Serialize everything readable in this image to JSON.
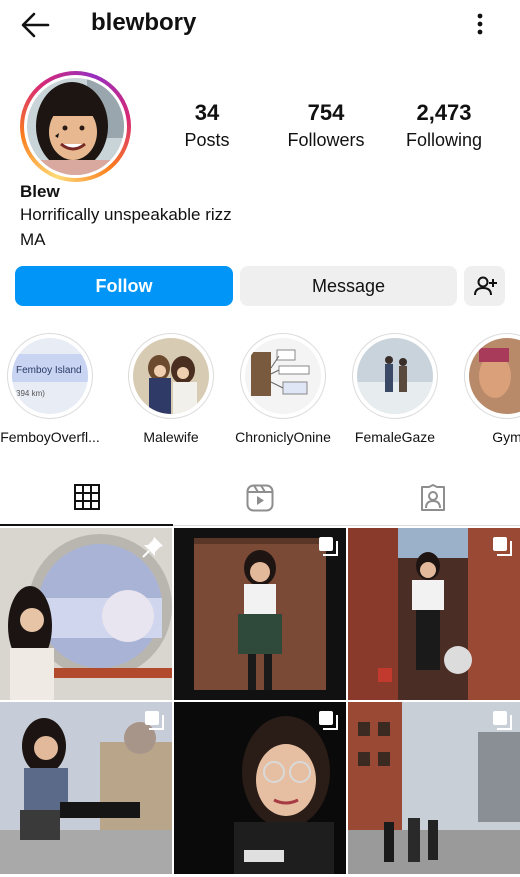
{
  "header": {
    "username": "blewbory"
  },
  "profile": {
    "name": "Blew",
    "bio": "Horrifically unspeakable rizz",
    "location": "MA"
  },
  "stats": [
    {
      "value": "34",
      "label": "Posts"
    },
    {
      "value": "754",
      "label": "Followers"
    },
    {
      "value": "2,473",
      "label": "Following"
    }
  ],
  "actions": {
    "follow_label": "Follow",
    "message_label": "Message"
  },
  "highlights": [
    {
      "label": "FemboyOverfl...",
      "image_text": "Femboy Island",
      "image_subtext": "394 km)"
    },
    {
      "label": "Malewife"
    },
    {
      "label": "ChroniclyOnine"
    },
    {
      "label": "FemaleGaze"
    },
    {
      "label": "Gym"
    }
  ],
  "tabs": [
    {
      "icon": "grid-icon"
    },
    {
      "icon": "reels-icon"
    },
    {
      "icon": "tagged-icon"
    }
  ],
  "colors": {
    "follow_blue": "#0095f6",
    "button_gray": "#efefef",
    "divider": "#dbdbdb"
  },
  "posts": [
    {
      "badge": "pin-icon"
    },
    {
      "badge": "multiple-icon"
    },
    {
      "badge": "multiple-icon"
    },
    {
      "badge": "multiple-icon"
    },
    {
      "badge": "multiple-icon"
    },
    {
      "badge": "multiple-icon"
    }
  ]
}
